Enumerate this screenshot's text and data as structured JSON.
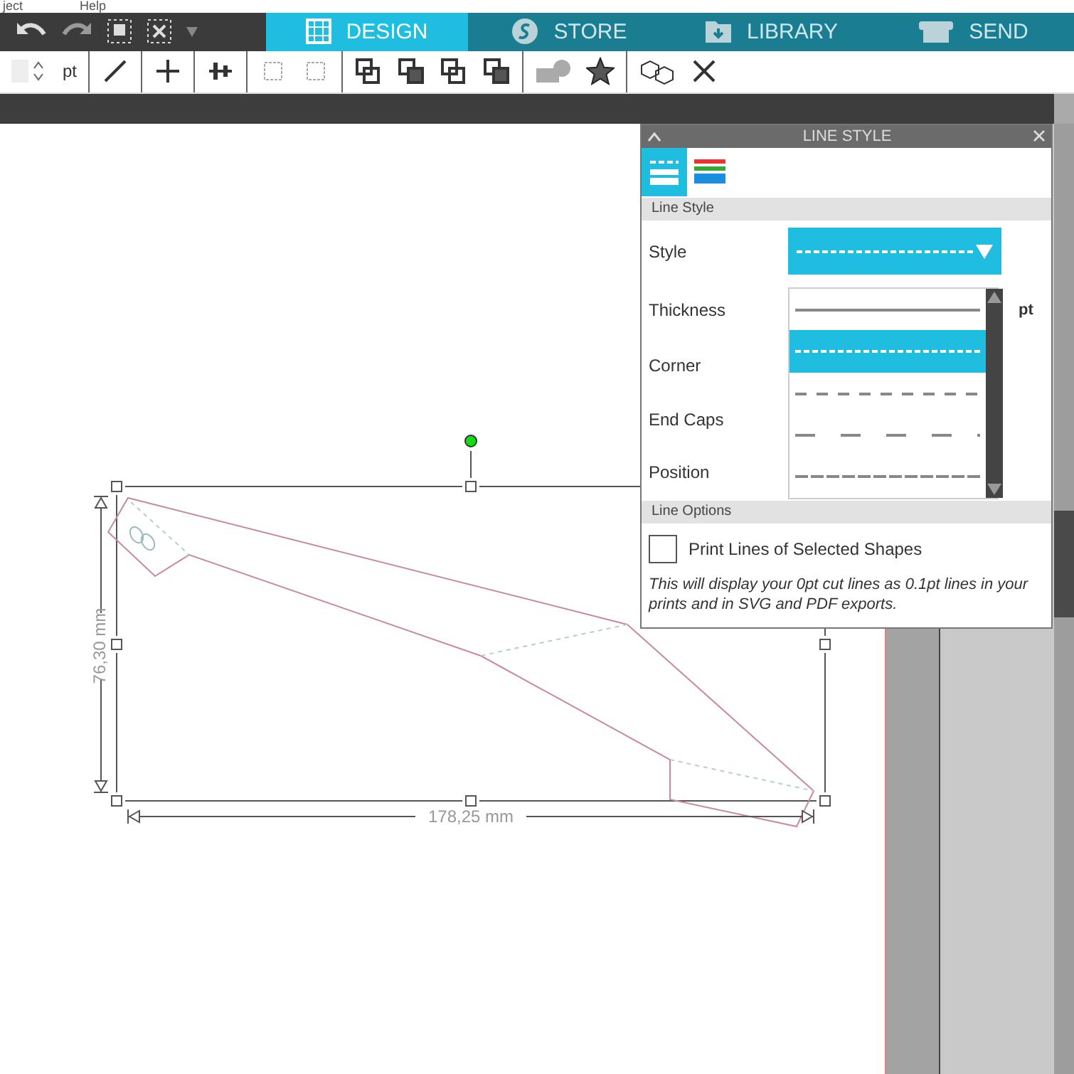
{
  "menu": [
    {
      "label": "ject"
    },
    {
      "label": "Help"
    }
  ],
  "tabs": [
    {
      "label": "DESIGN",
      "kind": "design",
      "selected": true
    },
    {
      "label": "STORE",
      "kind": "store",
      "selected": false
    },
    {
      "label": "LIBRARY",
      "kind": "library",
      "selected": false
    },
    {
      "label": "SEND",
      "kind": "send",
      "selected": false
    }
  ],
  "toolbar": {
    "unit": "pt"
  },
  "canvas": {
    "height_label": "76,30 mm",
    "width_label": "178,25 mm"
  },
  "panel": {
    "title": "LINE STYLE",
    "tabs": [
      {
        "kind": "line-style",
        "selected": true
      },
      {
        "kind": "line-color",
        "selected": false
      }
    ],
    "style_section": "Line Style",
    "fields": [
      {
        "label": "Style"
      },
      {
        "label": "Thickness"
      },
      {
        "label": "Corner"
      },
      {
        "label": "End Caps"
      },
      {
        "label": "Position"
      }
    ],
    "style_dropdown": {
      "kind": "dashed",
      "options": [
        {
          "kind": "solid",
          "selected": false
        },
        {
          "kind": "dashed",
          "selected": true
        },
        {
          "kind": "dash",
          "selected": false
        },
        {
          "kind": "long-dash",
          "selected": false
        },
        {
          "kind": "dash-dot",
          "selected": false
        }
      ]
    },
    "thickness_unit": "pt",
    "options_section": "Line Options",
    "print_lines": {
      "label": "Print Lines of Selected Shapes",
      "checked": false
    },
    "note": "This will display your 0pt cut lines as 0.1pt lines in your prints and in SVG and PDF exports."
  }
}
